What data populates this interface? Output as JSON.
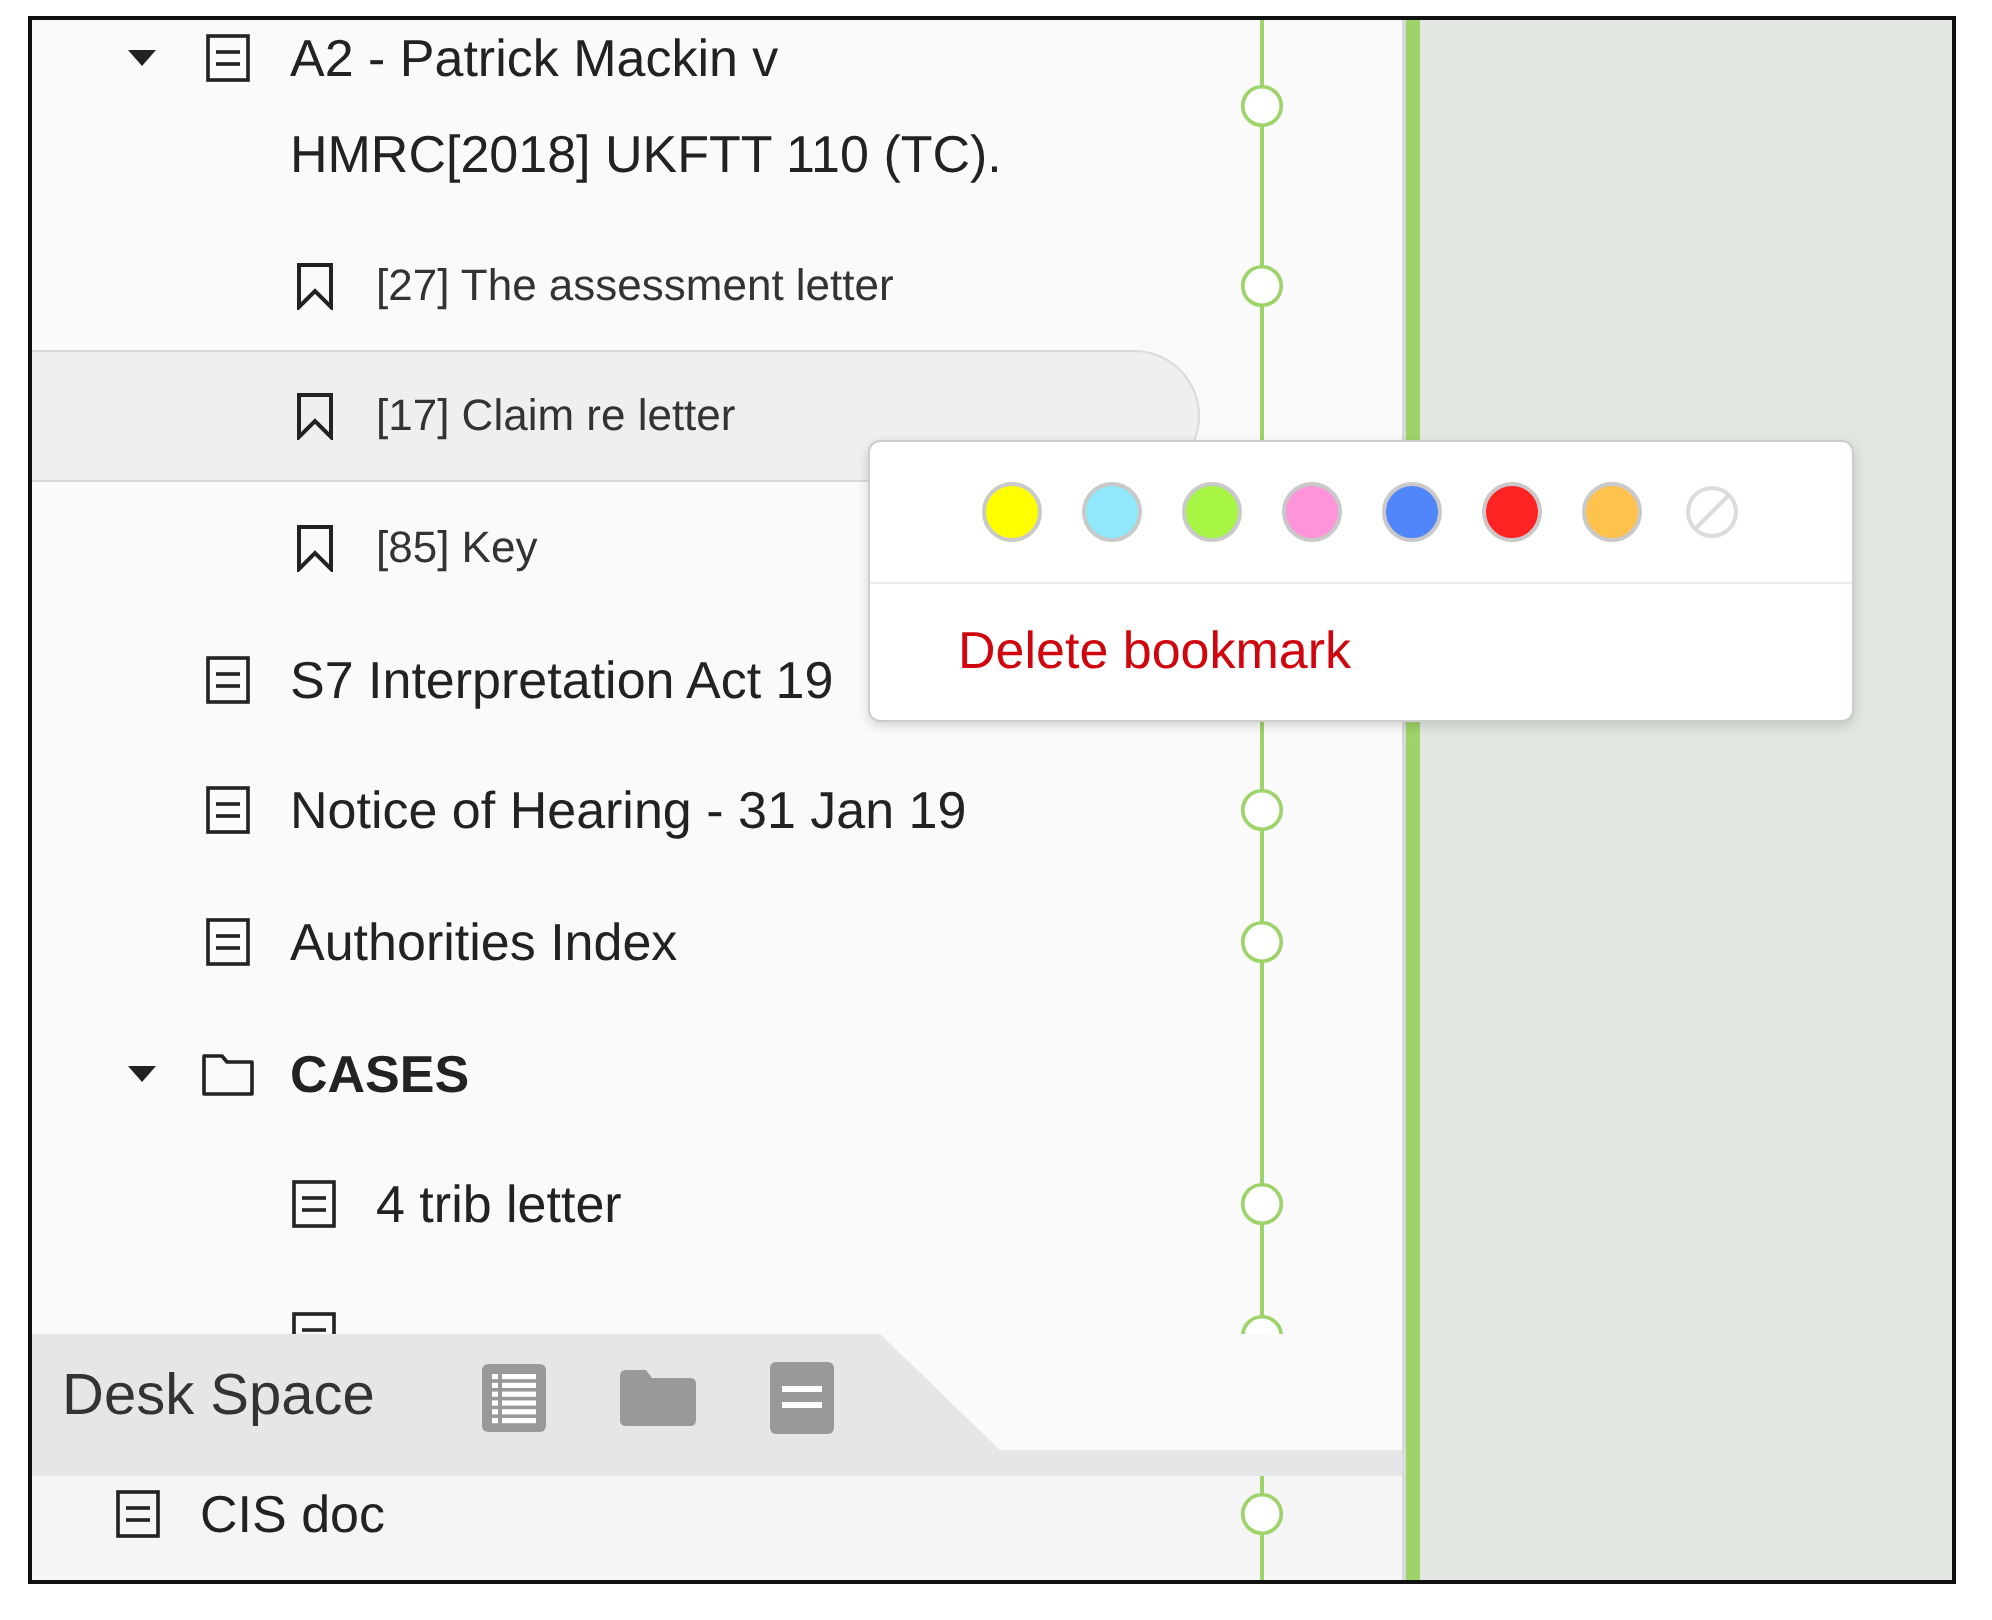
{
  "tree": [
    {
      "kind": "document",
      "label": "A2 - Patrick Mackin v HMRC[2018] UKFTT 110 (TC).",
      "selected": false,
      "expanded": true,
      "children": [
        {
          "kind": "bookmark",
          "label": "[27] The assessment letter",
          "selected": false
        },
        {
          "kind": "bookmark",
          "label": "[17] Claim re letter",
          "selected": true
        },
        {
          "kind": "bookmark",
          "label": "[85] Key",
          "selected": false
        }
      ]
    },
    {
      "kind": "document",
      "label": "S7 Interpretation Act 19",
      "selected": false
    },
    {
      "kind": "document",
      "label": "Notice of Hearing - 31 Jan 19",
      "selected": false
    },
    {
      "kind": "document",
      "label": "Authorities Index",
      "selected": false
    },
    {
      "kind": "folder",
      "label": "CASES",
      "selected": false,
      "expanded": true,
      "children": [
        {
          "kind": "document",
          "label": "4 trib letter",
          "selected": false
        },
        {
          "kind": "document",
          "selected": false
        }
      ]
    }
  ],
  "desk_space": {
    "title": "Desk Space",
    "tools": [
      {
        "kind": "list"
      },
      {
        "kind": "folder"
      },
      {
        "kind": "document"
      }
    ]
  },
  "desk_items": [
    {
      "kind": "document",
      "label": "CIS doc",
      "selected": false
    }
  ],
  "bookmark_menu": {
    "colors": [
      {
        "kind": "swatch",
        "color": "#ffff00"
      },
      {
        "kind": "swatch",
        "color": "#90e9fb"
      },
      {
        "kind": "swatch",
        "color": "#a6f543"
      },
      {
        "kind": "swatch",
        "color": "#ff95d8"
      },
      {
        "kind": "swatch",
        "color": "#5086fa"
      },
      {
        "kind": "swatch",
        "color": "#ff2323"
      },
      {
        "kind": "swatch",
        "color": "#ffc24c"
      },
      {
        "kind": "none"
      }
    ],
    "action": "Delete bookmark"
  }
}
